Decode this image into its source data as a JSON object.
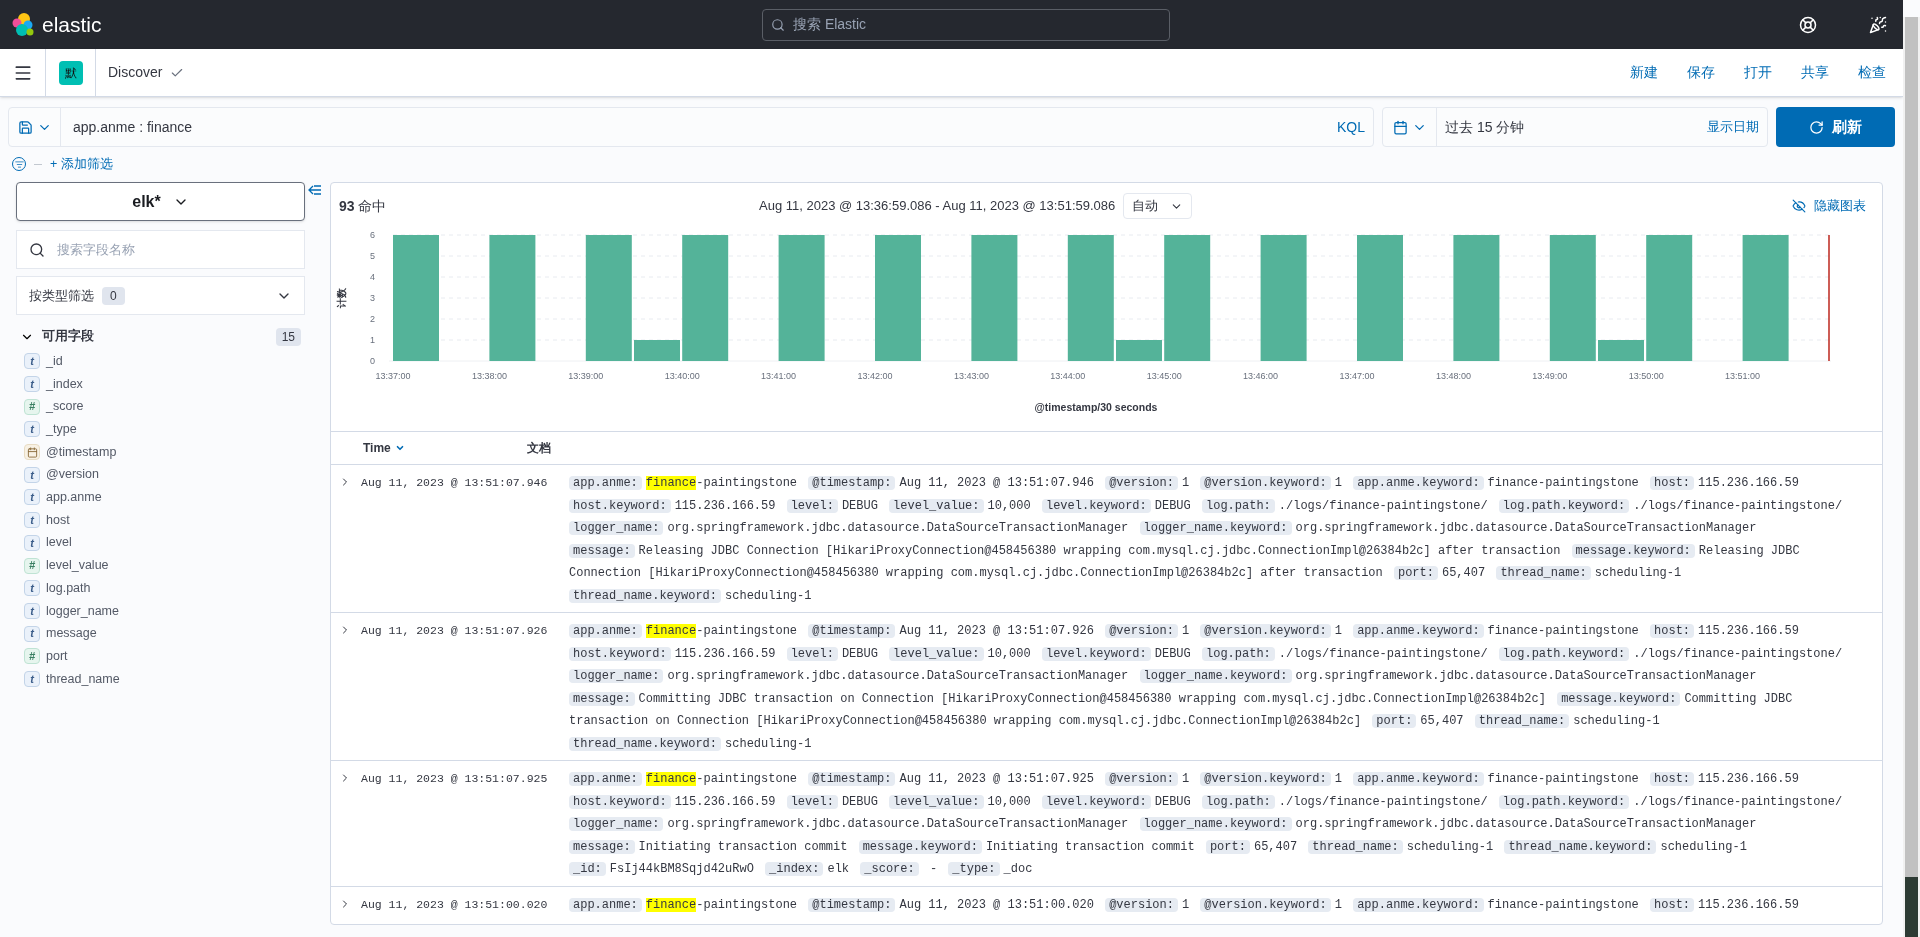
{
  "header": {
    "logo_text": "elastic",
    "search_placeholder": "搜索 Elastic"
  },
  "app_bar": {
    "space_badge": "默",
    "breadcrumb": "Discover",
    "actions": [
      "新建",
      "保存",
      "打开",
      "共享",
      "检查"
    ]
  },
  "query": {
    "value": "app.anme : finance",
    "language": "KQL"
  },
  "time": {
    "value": "过去 15 分钟",
    "show_dates": "显示日期",
    "refresh": "刷新"
  },
  "add_filter": "+ 添加筛选",
  "sidebar": {
    "index_pattern": "elk*",
    "field_search_placeholder": "搜索字段名称",
    "type_filter": {
      "label": "按类型筛选",
      "count": "0"
    },
    "available": {
      "label": "可用字段",
      "count": "15",
      "expanded": true
    },
    "fields": [
      {
        "name": "_id",
        "kind": "string",
        "glyph": "t"
      },
      {
        "name": "_index",
        "kind": "string",
        "glyph": "t"
      },
      {
        "name": "_score",
        "kind": "number",
        "glyph": "#"
      },
      {
        "name": "_type",
        "kind": "string",
        "glyph": "t"
      },
      {
        "name": "@timestamp",
        "kind": "date"
      },
      {
        "name": "@version",
        "kind": "string",
        "glyph": "t"
      },
      {
        "name": "app.anme",
        "kind": "string",
        "glyph": "t"
      },
      {
        "name": "host",
        "kind": "string",
        "glyph": "t"
      },
      {
        "name": "level",
        "kind": "string",
        "glyph": "t"
      },
      {
        "name": "level_value",
        "kind": "number",
        "glyph": "#"
      },
      {
        "name": "log.path",
        "kind": "string",
        "glyph": "t"
      },
      {
        "name": "logger_name",
        "kind": "string",
        "glyph": "t"
      },
      {
        "name": "message",
        "kind": "string",
        "glyph": "t"
      },
      {
        "name": "port",
        "kind": "number",
        "glyph": "#"
      },
      {
        "name": "thread_name",
        "kind": "string",
        "glyph": "t"
      }
    ]
  },
  "hits": {
    "count": "93",
    "label": "命中",
    "range": "Aug 11, 2023 @ 13:36:59.086 - Aug 11, 2023 @ 13:51:59.086",
    "interval": "自动",
    "hide_chart": "隐藏图表",
    "chart_data": {
      "type": "bar",
      "xlabel": "@timestamp/30 seconds",
      "ylabel": "计数",
      "categories": [
        "13:37:00",
        null,
        "13:38:00",
        null,
        "13:39:00",
        null,
        "13:40:00",
        null,
        "13:41:00",
        null,
        "13:42:00",
        null,
        "13:43:00",
        null,
        "13:44:00",
        null,
        "13:45:00",
        null,
        "13:46:00",
        null,
        "13:47:00",
        null,
        "13:48:00",
        null,
        "13:49:00",
        null,
        "13:50:00",
        null,
        "13:51:00",
        null
      ],
      "grid": true,
      "ylim": [
        0,
        6
      ],
      "series": [
        {
          "color": "#54b399",
          "values": [
            6,
            0,
            6,
            0,
            6,
            1,
            6,
            0,
            6,
            0,
            6,
            0,
            6,
            0,
            6,
            1,
            6,
            0,
            6,
            0,
            6,
            0,
            6,
            0,
            6,
            1,
            6,
            0,
            6,
            0
          ]
        }
      ],
      "yticks": [
        0,
        1,
        2,
        3,
        4,
        5,
        6
      ]
    }
  },
  "table": {
    "columns": [
      {
        "label": "Time",
        "sorted": true
      },
      {
        "label": "文档",
        "sorted": false
      }
    ],
    "rows": [
      {
        "time": "Aug 11, 2023 @ 13:51:07.946",
        "fields": [
          {
            "key": "app.anme:",
            "highlight": "finance",
            "value": "-paintingstone"
          },
          {
            "key": "@timestamp:",
            "value": "Aug 11, 2023 @ 13:51:07.946"
          },
          {
            "key": "@version:",
            "value": "1"
          },
          {
            "key": "@version.keyword:",
            "value": "1"
          },
          {
            "key": "app.anme.keyword:",
            "value": "finance-paintingstone"
          },
          {
            "key": "host:",
            "value": "115.236.166.59"
          },
          {
            "key": "host.keyword:",
            "value": "115.236.166.59"
          },
          {
            "key": "level:",
            "value": "DEBUG"
          },
          {
            "key": "level_value:",
            "value": "10,000"
          },
          {
            "key": "level.keyword:",
            "value": "DEBUG"
          },
          {
            "key": "log.path:",
            "value": "./logs/finance-paintingstone/"
          },
          {
            "key": "log.path.keyword:",
            "value": "./logs/finance-paintingstone/"
          },
          {
            "key": "logger_name:",
            "value": "org.springframework.jdbc.datasource.DataSourceTransactionManager"
          },
          {
            "key": "logger_name.keyword:",
            "value": "org.springframework.jdbc.datasource.DataSourceTransactionManager"
          },
          {
            "key": "message:",
            "value": "Releasing JDBC Connection [HikariProxyConnection@458456380 wrapping com.mysql.cj.jdbc.ConnectionImpl@26384b2c] after transaction"
          },
          {
            "key": "message.keyword:",
            "value": "Releasing JDBC Connection [HikariProxyConnection@458456380 wrapping com.mysql.cj.jdbc.ConnectionImpl@26384b2c] after transaction"
          },
          {
            "key": "port:",
            "value": "65,407"
          },
          {
            "key": "thread_name:",
            "value": "scheduling-1"
          },
          {
            "key": "thread_name.keyword:",
            "value": "scheduling-1"
          }
        ]
      },
      {
        "time": "Aug 11, 2023 @ 13:51:07.926",
        "fields": [
          {
            "key": "app.anme:",
            "highlight": "finance",
            "value": "-paintingstone"
          },
          {
            "key": "@timestamp:",
            "value": "Aug 11, 2023 @ 13:51:07.926"
          },
          {
            "key": "@version:",
            "value": "1"
          },
          {
            "key": "@version.keyword:",
            "value": "1"
          },
          {
            "key": "app.anme.keyword:",
            "value": "finance-paintingstone"
          },
          {
            "key": "host:",
            "value": "115.236.166.59"
          },
          {
            "key": "host.keyword:",
            "value": "115.236.166.59"
          },
          {
            "key": "level:",
            "value": "DEBUG"
          },
          {
            "key": "level_value:",
            "value": "10,000"
          },
          {
            "key": "level.keyword:",
            "value": "DEBUG"
          },
          {
            "key": "log.path:",
            "value": "./logs/finance-paintingstone/"
          },
          {
            "key": "log.path.keyword:",
            "value": "./logs/finance-paintingstone/"
          },
          {
            "key": "logger_name:",
            "value": "org.springframework.jdbc.datasource.DataSourceTransactionManager"
          },
          {
            "key": "logger_name.keyword:",
            "value": "org.springframework.jdbc.datasource.DataSourceTransactionManager"
          },
          {
            "key": "message:",
            "value": "Committing JDBC transaction on Connection [HikariProxyConnection@458456380 wrapping com.mysql.cj.jdbc.ConnectionImpl@26384b2c]"
          },
          {
            "key": "message.keyword:",
            "value": "Committing JDBC transaction on Connection [HikariProxyConnection@458456380 wrapping com.mysql.cj.jdbc.ConnectionImpl@26384b2c]"
          },
          {
            "key": "port:",
            "value": "65,407"
          },
          {
            "key": "thread_name:",
            "value": "scheduling-1"
          },
          {
            "key": "thread_name.keyword:",
            "value": "scheduling-1"
          }
        ]
      },
      {
        "time": "Aug 11, 2023 @ 13:51:07.925",
        "fields": [
          {
            "key": "app.anme:",
            "highlight": "finance",
            "value": "-paintingstone"
          },
          {
            "key": "@timestamp:",
            "value": "Aug 11, 2023 @ 13:51:07.925"
          },
          {
            "key": "@version:",
            "value": "1"
          },
          {
            "key": "@version.keyword:",
            "value": "1"
          },
          {
            "key": "app.anme.keyword:",
            "value": "finance-paintingstone"
          },
          {
            "key": "host:",
            "value": "115.236.166.59"
          },
          {
            "key": "host.keyword:",
            "value": "115.236.166.59"
          },
          {
            "key": "level:",
            "value": "DEBUG"
          },
          {
            "key": "level_value:",
            "value": "10,000"
          },
          {
            "key": "level.keyword:",
            "value": "DEBUG"
          },
          {
            "key": "log.path:",
            "value": "./logs/finance-paintingstone/"
          },
          {
            "key": "log.path.keyword:",
            "value": "./logs/finance-paintingstone/"
          },
          {
            "key": "logger_name:",
            "value": "org.springframework.jdbc.datasource.DataSourceTransactionManager"
          },
          {
            "key": "logger_name.keyword:",
            "value": "org.springframework.jdbc.datasource.DataSourceTransactionManager"
          },
          {
            "key": "message:",
            "value": "Initiating transaction commit"
          },
          {
            "key": "message.keyword:",
            "value": "Initiating transaction commit"
          },
          {
            "key": "port:",
            "value": "65,407"
          },
          {
            "key": "thread_name:",
            "value": "scheduling-1"
          },
          {
            "key": "thread_name.keyword:",
            "value": "scheduling-1"
          },
          {
            "key": "_id:",
            "value": "FsIj44kBM8Sqjd42uRwO"
          },
          {
            "key": "_index:",
            "value": "elk"
          },
          {
            "key": "_score:",
            "value": " - "
          },
          {
            "key": "_type:",
            "value": "_doc"
          }
        ]
      },
      {
        "time": "Aug 11, 2023 @ 13:51:00.020",
        "fields": [
          {
            "key": "app.anme:",
            "highlight": "finance",
            "value": "-paintingstone"
          },
          {
            "key": "@timestamp:",
            "value": "Aug 11, 2023 @ 13:51:00.020"
          },
          {
            "key": "@version:",
            "value": "1"
          },
          {
            "key": "@version.keyword:",
            "value": "1"
          },
          {
            "key": "app.anme.keyword:",
            "value": "finance-paintingstone"
          },
          {
            "key": "host:",
            "value": "115.236.166.59"
          }
        ]
      }
    ]
  }
}
